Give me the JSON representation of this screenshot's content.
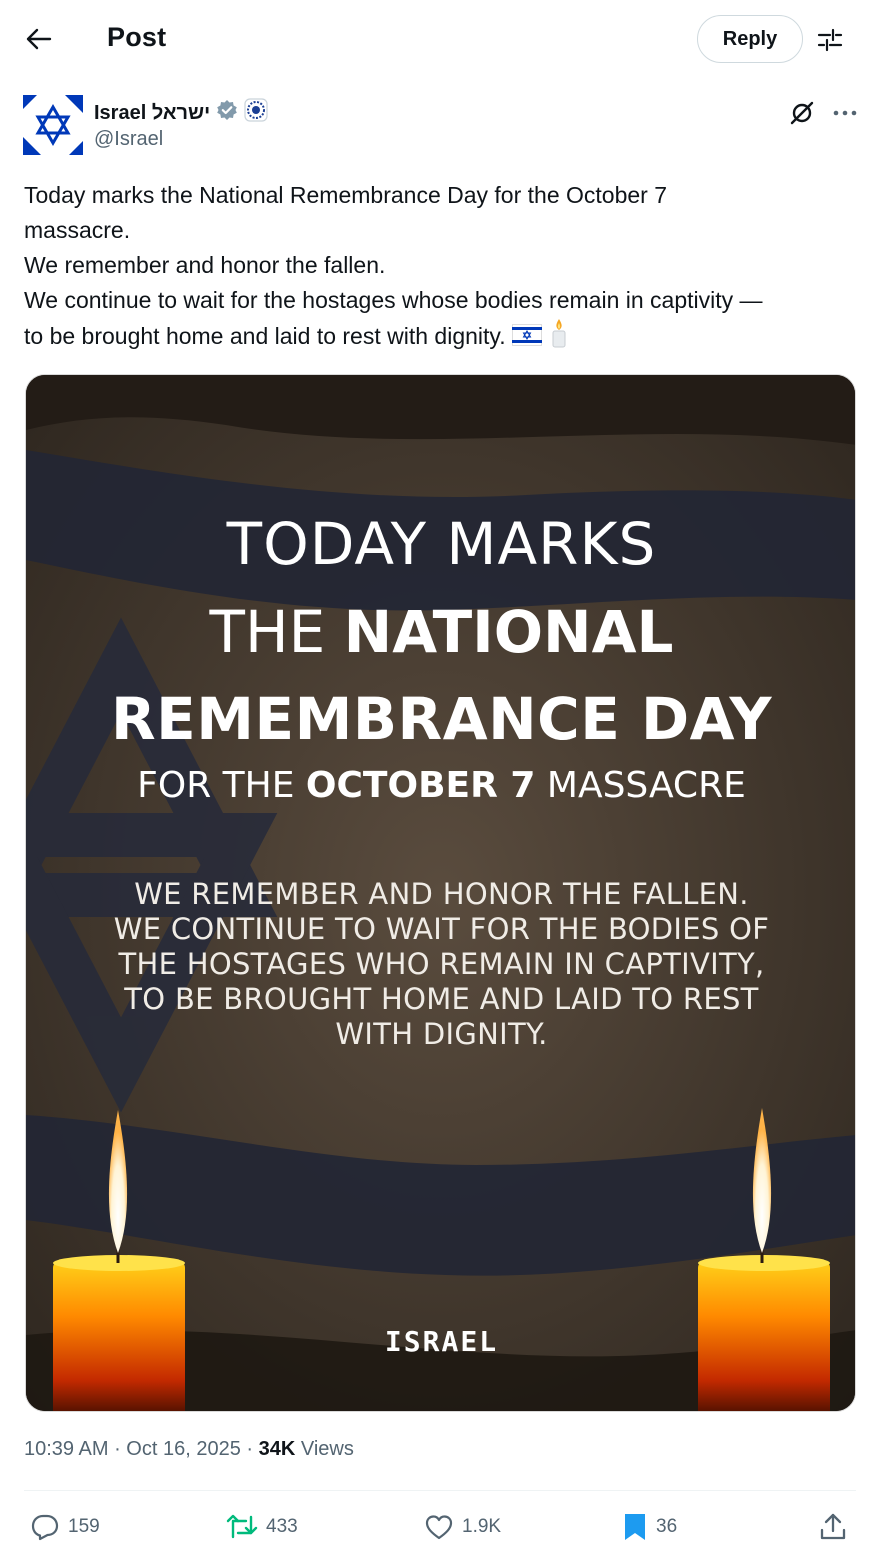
{
  "header": {
    "title": "Post",
    "reply_label": "Reply",
    "back_icon": "back-arrow-icon",
    "settings_icon": "sliders-icon"
  },
  "author": {
    "name": "Israel ישראל",
    "handle": "@Israel",
    "verified": true,
    "affiliation_badge": "government-emblem-icon"
  },
  "post": {
    "lines": [
      "Today marks the National Remembrance Day for the October 7",
      "massacre.",
      "We remember and honor the fallen.",
      "We continue to wait for the hostages whose bodies remain in captivity —",
      "to be brought home and laid to rest with dignity."
    ],
    "emojis": [
      "israel-flag-emoji",
      "candle-emoji"
    ]
  },
  "media": {
    "line1": "TODAY MARKS",
    "line2_light": "THE ",
    "line2_bold": "NATIONAL",
    "line3": "REMEMBRANCE DAY",
    "line4_a": "FOR THE ",
    "line4_bold": "OCTOBER 7",
    "line4_b": " MASSACRE",
    "body": [
      "WE REMEMBER AND HONOR THE FALLEN.",
      "WE CONTINUE TO WAIT FOR THE BODIES OF",
      "THE HOSTAGES WHO REMAIN IN CAPTIVITY,",
      "TO BE BROUGHT HOME AND LAID TO REST",
      "WITH DIGNITY."
    ],
    "logo": "ISRAEL"
  },
  "meta": {
    "time": "10:39 AM",
    "date": "Oct 16, 2025",
    "views_count": "34K",
    "views_label": "Views"
  },
  "actions": {
    "replies": "159",
    "reposts": "433",
    "likes": "1.9K",
    "bookmarks": "36"
  },
  "colors": {
    "text": "#0f1419",
    "secondary": "#536471",
    "repost_green": "#00ba7c",
    "bookmark_blue": "#1d9bf0",
    "israel_blue": "#0038b8"
  }
}
